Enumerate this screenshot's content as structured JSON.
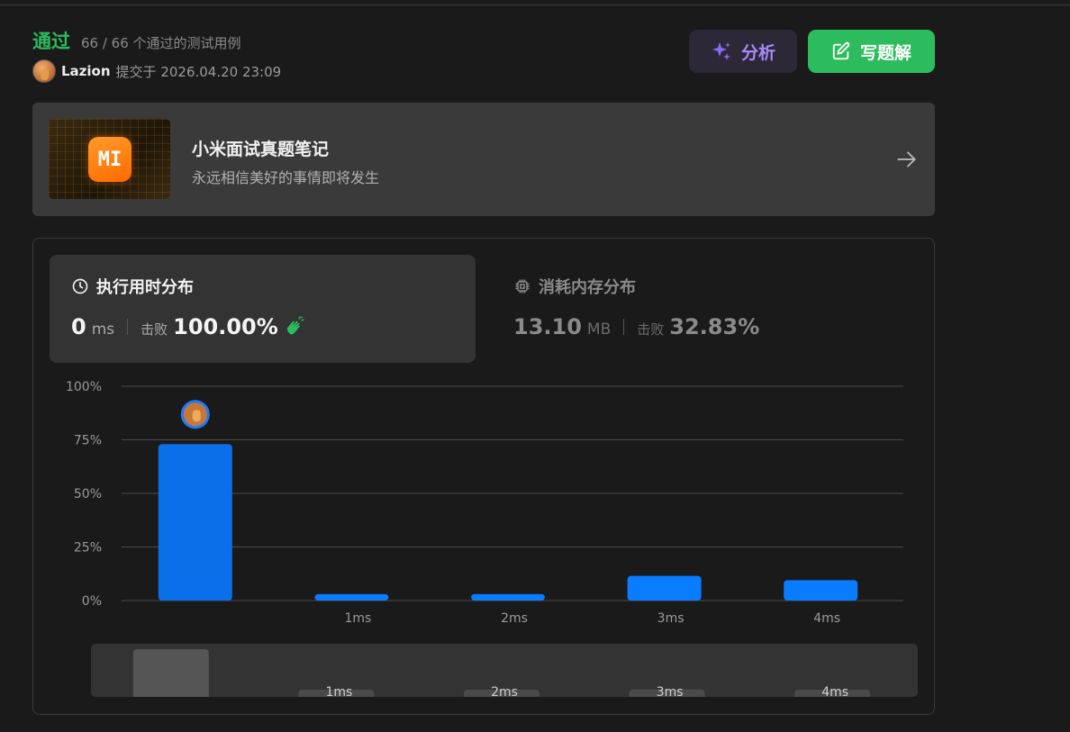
{
  "header": {
    "status": "通过",
    "cases": "66 / 66 个通过的测试用例",
    "username": "Lazion",
    "submitted": "提交于 2026.04.20 23:09"
  },
  "actions": {
    "analyze_label": "分析",
    "write_label": "写题解"
  },
  "banner": {
    "logo_text": "MI",
    "title": "小米面试真题笔记",
    "subtitle": "永远相信美好的事情即将发生"
  },
  "runtime": {
    "title": "执行用时分布",
    "value": "0",
    "unit": "ms",
    "beat_label": "击败",
    "beat_value": "100.00%"
  },
  "memory": {
    "title": "消耗内存分布",
    "value": "13.10",
    "unit": "MB",
    "beat_label": "击败",
    "beat_value": "32.83%"
  },
  "colors": {
    "accent_green": "#2cbb5d",
    "bar_selected": "#0a6fe8",
    "bar": "#0a7cff",
    "analyze_purple": "#a78bfa"
  },
  "chart_data": {
    "type": "bar",
    "categories": [
      "",
      "1ms",
      "2ms",
      "3ms",
      "4ms"
    ],
    "values": [
      73,
      3,
      3,
      11.5,
      9.5
    ],
    "selected_index": 0,
    "yticks": [
      "100%",
      "75%",
      "50%",
      "25%",
      "0%"
    ],
    "ylim": [
      0,
      100
    ],
    "grid": true
  }
}
